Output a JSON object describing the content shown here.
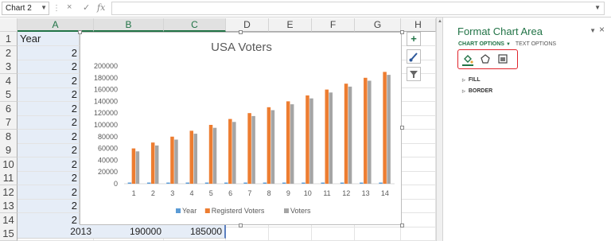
{
  "formula_bar": {
    "name_box": "Chart 2",
    "cancel_icon": "×",
    "enter_icon": "✓",
    "fx_label": "fx",
    "formula": ""
  },
  "columns": [
    "A",
    "B",
    "C",
    "D",
    "E",
    "F",
    "G",
    "H"
  ],
  "rows": [
    "1",
    "2",
    "3",
    "4",
    "5",
    "6",
    "7",
    "8",
    "9",
    "10",
    "11",
    "12",
    "13",
    "14",
    "15"
  ],
  "sheet": {
    "a1": "Year",
    "a_visible": "2",
    "row15": {
      "a": "2013",
      "b": "190000",
      "c": "185000"
    }
  },
  "chart_data": {
    "type": "bar",
    "title": "USA Voters",
    "categories": [
      "1",
      "2",
      "3",
      "4",
      "5",
      "6",
      "7",
      "8",
      "9",
      "10",
      "11",
      "12",
      "13",
      "14"
    ],
    "y_ticks": [
      "0",
      "20000",
      "40000",
      "60000",
      "80000",
      "100000",
      "120000",
      "140000",
      "160000",
      "180000",
      "200000"
    ],
    "ylim": [
      0,
      200000
    ],
    "legend": "bottom",
    "series": [
      {
        "name": "Year",
        "color": "#5b9bd5",
        "values": [
          2000,
          2001,
          2002,
          2003,
          2004,
          2005,
          2006,
          2007,
          2008,
          2009,
          2010,
          2011,
          2012,
          2013
        ]
      },
      {
        "name": "Registerd Voters",
        "color": "#ed7d31",
        "values": [
          60000,
          70000,
          80000,
          90000,
          100000,
          110000,
          120000,
          130000,
          140000,
          150000,
          160000,
          170000,
          180000,
          190000
        ]
      },
      {
        "name": "Voters",
        "color": "#a5a5a5",
        "values": [
          55000,
          65000,
          75000,
          85000,
          95000,
          105000,
          115000,
          125000,
          135000,
          145000,
          155000,
          165000,
          175000,
          185000
        ]
      }
    ]
  },
  "side_buttons": {
    "add": "+",
    "style": "brush-icon",
    "filter": "filter-icon"
  },
  "pane": {
    "title": "Format Chart Area",
    "close": "×",
    "tab_chart": "CHART OPTIONS",
    "tab_text": "TEXT OPTIONS",
    "sections": [
      "FILL",
      "BORDER"
    ]
  },
  "colors": {
    "accent": "#217346",
    "highlight": "#e0222a"
  }
}
